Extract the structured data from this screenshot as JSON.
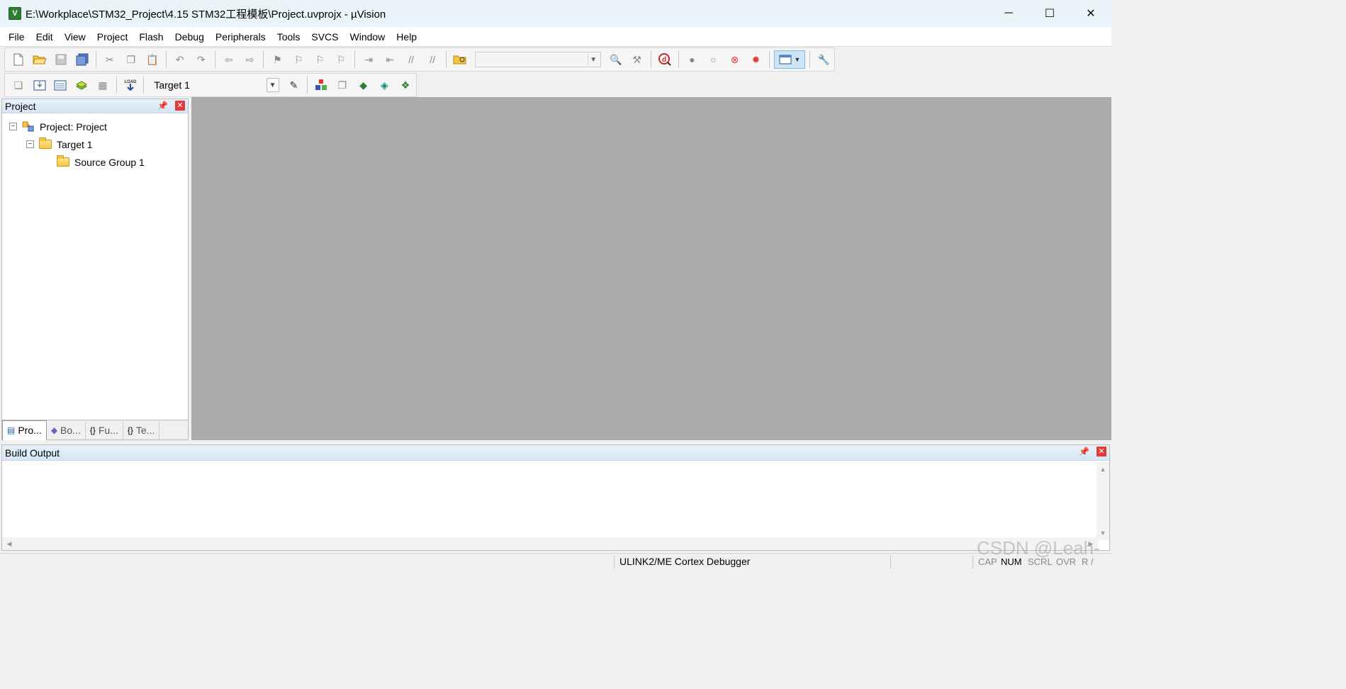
{
  "window": {
    "title": "E:\\Workplace\\STM32_Project\\4.15 STM32工程模板\\Project.uvprojx - µVision",
    "app_icon": "uvision-icon",
    "controls": {
      "minimize": "─",
      "maximize": "☐",
      "close": "✕"
    }
  },
  "menu": {
    "items": [
      "File",
      "Edit",
      "View",
      "Project",
      "Flash",
      "Debug",
      "Peripherals",
      "Tools",
      "SVCS",
      "Window",
      "Help"
    ]
  },
  "toolbar2": {
    "target_select": "Target 1"
  },
  "project_panel": {
    "title": "Project",
    "pin_icon": "📌",
    "close_icon": "✕",
    "tree": {
      "root": "Project: Project",
      "target": "Target 1",
      "group": "Source Group 1"
    },
    "tabs": [
      {
        "label": "Pro...",
        "icon": "▤"
      },
      {
        "label": "Bo...",
        "icon": "◆"
      },
      {
        "label": "Fu...",
        "icon": "{}"
      },
      {
        "label": "Te...",
        "icon": "{}"
      }
    ]
  },
  "build_output": {
    "title": "Build Output"
  },
  "statusbar": {
    "debugger": "ULINK2/ME Cortex Debugger",
    "cap": "CAP",
    "num": "NUM",
    "scrl": "SCRL",
    "ovr": "OVR",
    "rw": "R /"
  },
  "watermark": "CSDN @Leah-",
  "colors": {
    "editor_bg": "#ababab",
    "titlebar_bg": "#e9f3f8",
    "close_red": "#e53935"
  }
}
